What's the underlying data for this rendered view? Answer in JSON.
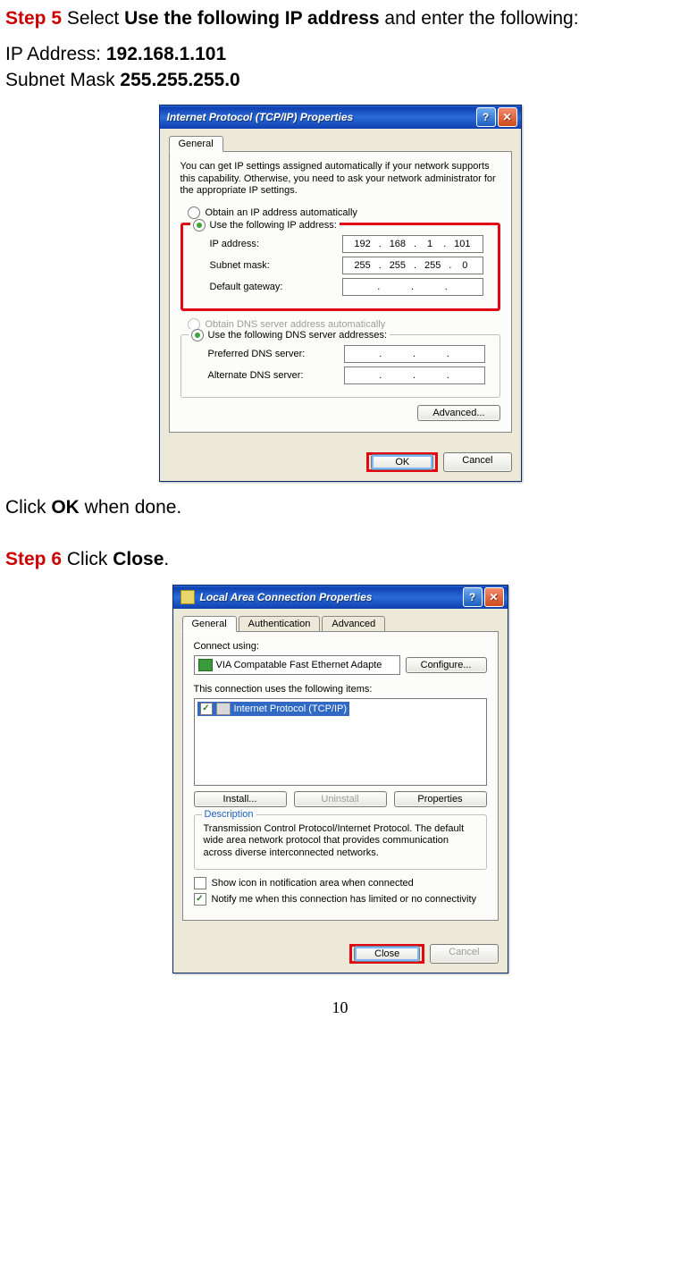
{
  "step5": {
    "label": "Step 5",
    "text_a": " Select ",
    "bold": "Use the following IP address",
    "text_b": " and enter the following:"
  },
  "ip_addr_line": {
    "label": "IP Address: ",
    "value": "192.168.1.101"
  },
  "subnet_line": {
    "label": "Subnet Mask ",
    "value": "255.255.255.0"
  },
  "dlg1": {
    "title": "Internet Protocol (TCP/IP) Properties",
    "tab": "General",
    "desc": "You can get IP settings assigned automatically if your network supports this capability. Otherwise, you need to ask your network administrator for the appropriate IP settings.",
    "opt_auto": "Obtain an IP address automatically",
    "opt_manual": "Use the following IP address:",
    "lbl_ip": "IP address:",
    "ip": {
      "a": "192",
      "b": "168",
      "c": "1",
      "d": "101"
    },
    "lbl_mask": "Subnet mask:",
    "mask": {
      "a": "255",
      "b": "255",
      "c": "255",
      "d": "0"
    },
    "lbl_gw": "Default gateway:",
    "opt_dns_auto": "Obtain DNS server address automatically",
    "opt_dns_manual": "Use the following DNS server addresses:",
    "lbl_pref": "Preferred DNS server:",
    "lbl_alt": "Alternate DNS server:",
    "advanced": "Advanced...",
    "ok": "OK",
    "cancel": "Cancel"
  },
  "click_ok": {
    "a": "Click ",
    "b": "OK",
    "c": " when done."
  },
  "step6": {
    "label": "Step 6",
    "text_a": " Click ",
    "bold": "Close",
    "text_b": "."
  },
  "dlg2": {
    "title": "Local Area Connection Properties",
    "tabs": {
      "general": "General",
      "auth": "Authentication",
      "adv": "Advanced"
    },
    "connect_using": "Connect using:",
    "adapter": "VIA Compatable Fast Ethernet Adapte",
    "configure": "Configure...",
    "items_label": "This connection uses the following items:",
    "item": "Internet Protocol (TCP/IP)",
    "install": "Install...",
    "uninstall": "Uninstall",
    "properties": "Properties",
    "desc_legend": "Description",
    "desc": "Transmission Control Protocol/Internet Protocol. The default wide area network protocol that provides communication across diverse interconnected networks.",
    "chk_showicon": "Show icon in notification area when connected",
    "chk_notify": "Notify me when this connection has limited or no connectivity",
    "close": "Close",
    "cancel": "Cancel"
  },
  "page_number": "10"
}
